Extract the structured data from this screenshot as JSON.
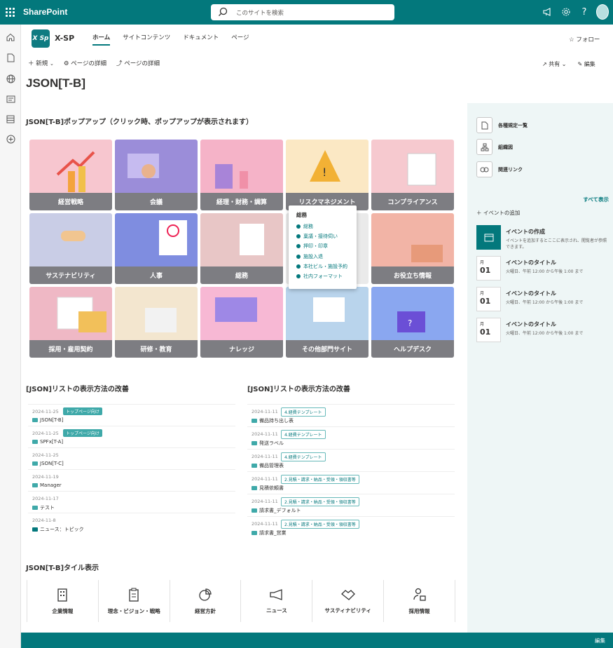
{
  "suite": {
    "brand": "SharePoint",
    "search_placeholder": "このサイトを検索"
  },
  "site": {
    "logo_text": "X Sp",
    "name": "X-SP",
    "nav": [
      "ホーム",
      "サイトコンテンツ",
      "ドキュメント",
      "ページ"
    ],
    "follow": "フォロー"
  },
  "command": {
    "new": "新規",
    "page_details_1": "ページの詳細",
    "page_details_2": "ページの詳細",
    "share": "共有",
    "edit": "編集"
  },
  "page": {
    "title": "JSON[T-B]"
  },
  "popup_section": {
    "title": "JSON[T-B]ポップアップ（クリック時、ポップアップが表示されます）"
  },
  "tiles": [
    {
      "label": "経営戦略",
      "color": "#f7c6cf"
    },
    {
      "label": "会議",
      "color": "#9b8dd9"
    },
    {
      "label": "経理・財務・調算",
      "color": "#f5b3c8"
    },
    {
      "label": "リスクマネジメント",
      "color": "#fbe8c4"
    },
    {
      "label": "コンプライアンス",
      "color": "#f6c9cf"
    },
    {
      "label": "サステナビリティ",
      "color": "#c9cde6"
    },
    {
      "label": "人事",
      "color": "#7f8de0"
    },
    {
      "label": "総務",
      "color": "#e8c6c6"
    },
    {
      "label": "",
      "color": "#eaeaea"
    },
    {
      "label": "お役立ち情報",
      "color": "#f2b4a6"
    },
    {
      "label": "採用・雇用契約",
      "color": "#efb8c5"
    },
    {
      "label": "研修・教育",
      "color": "#f3e6cf"
    },
    {
      "label": "ナレッジ",
      "color": "#f7b8d4"
    },
    {
      "label": "その他部門サイト",
      "color": "#b9d4ec"
    },
    {
      "label": "ヘルプデスク",
      "color": "#8aa7f0"
    }
  ],
  "popup": {
    "title": "総務",
    "items": [
      "総務",
      "稟議・接待伺い",
      "押印・印章",
      "施設入退",
      "本社ビル・施設予約",
      "社内フォーマット"
    ]
  },
  "list_left": {
    "title": "[JSON]リストの表示方法の改善",
    "rows": [
      {
        "date": "2024-11-25",
        "tag": "トップページ向け",
        "name": "JSON[T-B]"
      },
      {
        "date": "2024-11-25",
        "tag": "トップページ向け",
        "name": "SPFx[T-A]"
      },
      {
        "date": "2024-11-25",
        "tag": "",
        "name": "JSON[T-C]"
      },
      {
        "date": "2024-11-19",
        "tag": "",
        "name": "Manager"
      },
      {
        "date": "2024-11-17",
        "tag": "",
        "name": "テスト"
      },
      {
        "date": "2024-11-8",
        "tag": "",
        "name": "ニュース：トピック"
      }
    ]
  },
  "list_right": {
    "title": "[JSON]リストの表示方法の改善",
    "rows": [
      {
        "date": "2024-11-11",
        "tag": "4.経費テンプレート",
        "name": "備品持ち出し表"
      },
      {
        "date": "2024-11-11",
        "tag": "4.経費テンプレート",
        "name": "発送ラベル"
      },
      {
        "date": "2024-11-11",
        "tag": "4.経費テンプレート",
        "name": "備品管理表"
      },
      {
        "date": "2024-11-11",
        "tag": "2.見積・請求・納品・受領・領収書等",
        "name": "見積依頼書"
      },
      {
        "date": "2024-11-11",
        "tag": "2.見積・請求・納品・受領・領収書等",
        "name": "請求書_デフォルト"
      },
      {
        "date": "2024-11-11",
        "tag": "2.見積・請求・納品・受領・領収書等",
        "name": "請求書_営業"
      }
    ]
  },
  "tile_section": {
    "title": "JSON[T-B]タイル表示",
    "items": [
      "企業情報",
      "理念・ビジョン・戦略",
      "経営方針",
      "ニュース",
      "サスティナビリティ",
      "採用情報"
    ]
  },
  "right_pane": {
    "links": [
      "各種規定一覧",
      "組織図",
      "関連リンク"
    ],
    "show_all": "すべて表示",
    "add_event": "イベントの追加",
    "create_title": "イベントの作成",
    "create_desc": "イベントを追加するとここに表示され、閲覧者が参照できます。",
    "events": [
      {
        "month": "月",
        "day": "01",
        "title": "イベントのタイトル",
        "time": "火曜日、午前 12:00 から午後 1:00 まで"
      },
      {
        "month": "月",
        "day": "01",
        "title": "イベントのタイトル",
        "time": "火曜日、午前 12:00 から午後 1:00 まで"
      },
      {
        "month": "月",
        "day": "01",
        "title": "イベントのタイトル",
        "time": "火曜日、午前 12:00 から午後 1:00 まで"
      }
    ]
  },
  "footer": {
    "edit": "編集"
  }
}
